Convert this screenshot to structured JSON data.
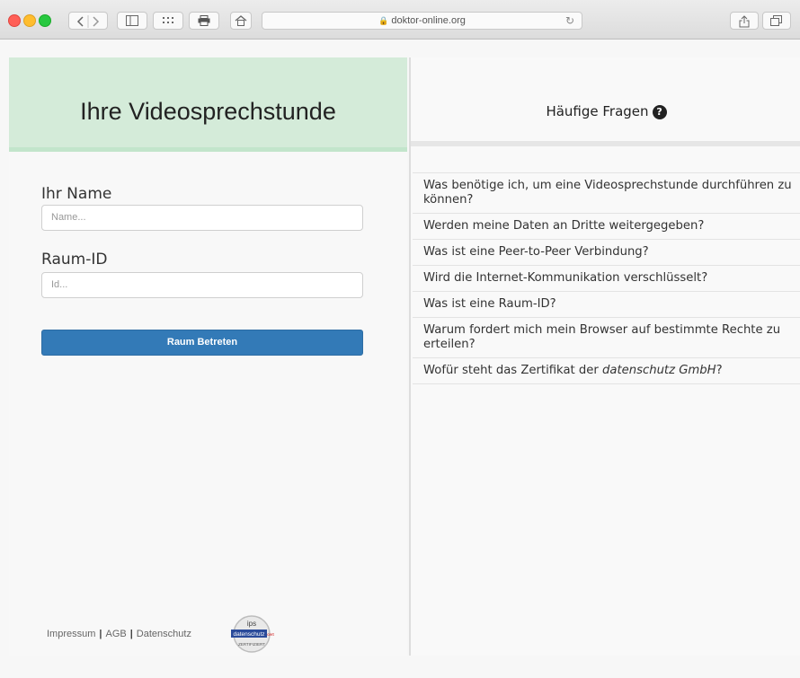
{
  "browser": {
    "url": "doktor-online.org",
    "lock_glyph": "🔒",
    "reload_glyph": "↻"
  },
  "left": {
    "title": "Ihre Videosprechstunde",
    "name_label": "Ihr Name",
    "name_placeholder": "Name...",
    "room_label": "Raum-ID",
    "room_placeholder": "Id...",
    "join_button": "Raum Betreten"
  },
  "footer": {
    "links": [
      "Impressum",
      "AGB",
      "Datenschutz"
    ],
    "separator": "|",
    "badge_top": "ips",
    "badge_mid": "datenschutz",
    "badge_mid_suffix": "cert",
    "badge_bottom": "ZERTIFIZIERT"
  },
  "faq": {
    "title": "Häufige Fragen",
    "help_icon": "?",
    "items": [
      "Was benötige ich, um eine Videosprechstunde durchführen zu können?",
      "Werden meine Daten an Dritte weitergegeben?",
      "Was ist eine Peer-to-Peer Verbindung?",
      "Wird die Internet-Kommunikation verschlüsselt?",
      "Was ist eine Raum-ID?",
      "Warum fordert mich mein Browser auf bestimmte Rechte zu erteilen?"
    ],
    "last_item_prefix": "Wofür steht das Zertifikat der ",
    "last_item_em": "datenschutz GmbH",
    "last_item_suffix": "?"
  },
  "colors": {
    "hero_bg": "#d4ebd9",
    "button_bg": "#337ab7"
  }
}
